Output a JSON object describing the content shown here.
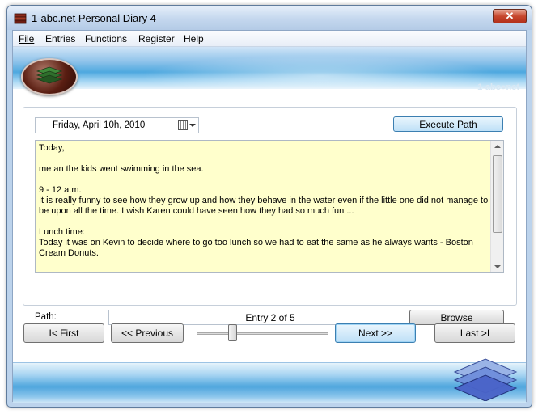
{
  "window": {
    "title": "1-abc.net Personal Diary 4",
    "close_label": "✕"
  },
  "menu": {
    "file": "File",
    "entries": "Entries",
    "functions": "Functions",
    "register": "Register",
    "help": "Help"
  },
  "brand": {
    "text": "1-abc●net"
  },
  "entry": {
    "date": "Friday, April 10h, 2010",
    "execute_label": "Execute Path",
    "text": "Today,\n\nme an the kids went swimming in the sea.\n\n9 - 12 a.m.\nIt is really funny to see how they grow up and how they behave in the water even if the little one did not manage to be upon all the time. I wish Karen could have seen how they had so much fun ...\n\nLunch time:\nToday it was on Kevin to decide where to go too lunch so we had to eat the same as he always wants - Boston Cream Donuts.",
    "path_label": "Path:",
    "path_value": "",
    "browse_label": "Browse"
  },
  "navigation": {
    "counter": "Entry 2 of 5",
    "first_label": "I< First",
    "previous_label": "<< Previous",
    "next_label": "Next >>",
    "last_label": "Last >I",
    "current": 2,
    "total": 5
  },
  "colors": {
    "editor_bg": "#ffffcc",
    "accent": "#3c7fb1"
  }
}
